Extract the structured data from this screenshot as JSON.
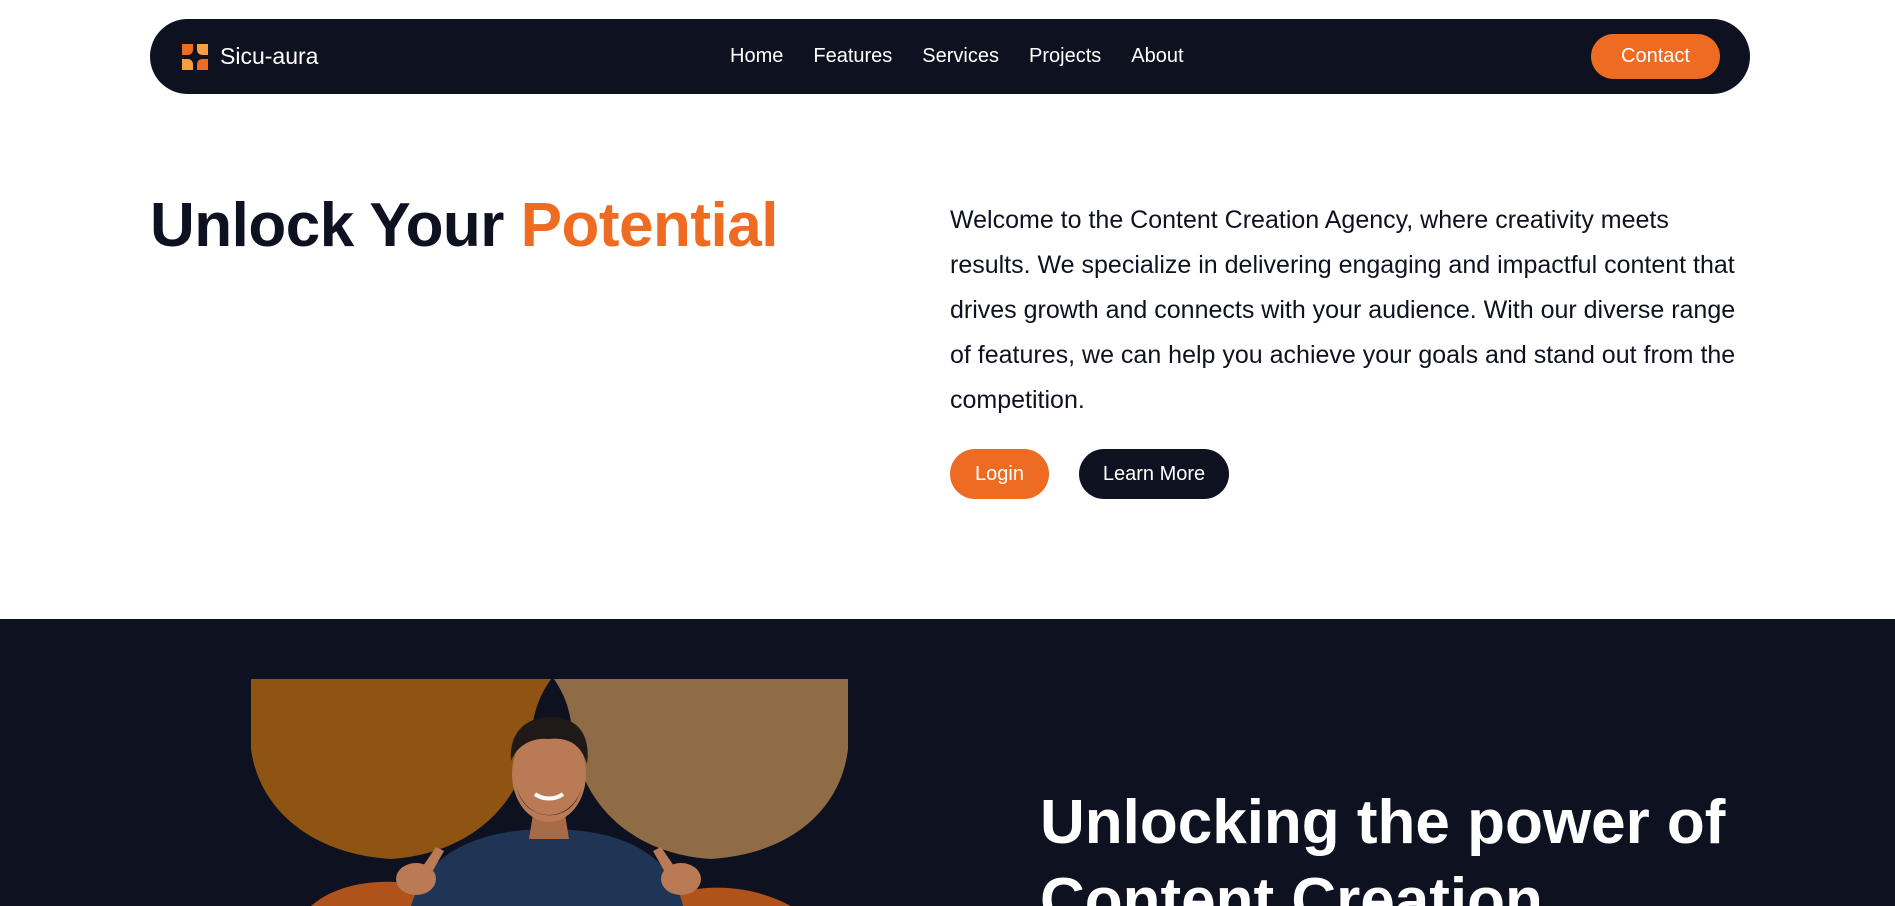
{
  "nav": {
    "brand": "Sicu-aura",
    "links": [
      "Home",
      "Features",
      "Services",
      "Projects",
      "About"
    ],
    "contact_label": "Contact"
  },
  "hero": {
    "title_main": "Unlock Your ",
    "title_accent": "Potential",
    "description": "Welcome to the Content Creation Agency, where creativity meets results. We specialize in delivering engaging and impactful content that drives growth and connects with your audience. With our diverse range of features, we can help you achieve your goals and stand out from the competition.",
    "login_label": "Login",
    "learn_more_label": "Learn More"
  },
  "section": {
    "title": "Unlocking the power of Content Creation"
  },
  "colors": {
    "accent": "#ee6b22",
    "dark": "#0e1120",
    "white": "#ffffff"
  }
}
